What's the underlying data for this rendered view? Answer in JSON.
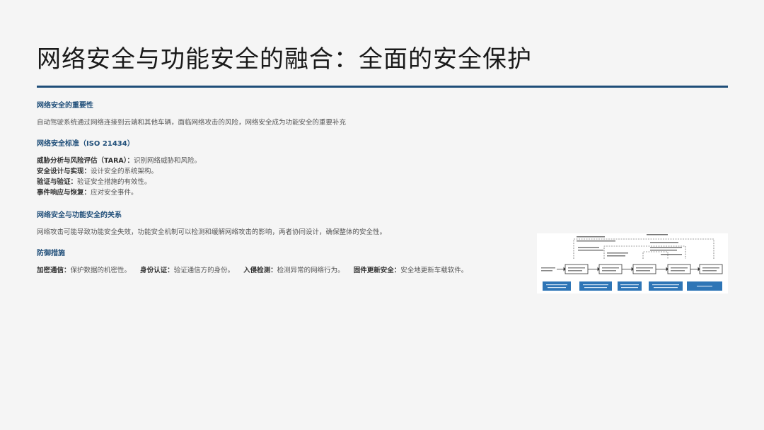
{
  "title": "网络安全与功能安全的融合：全面的安全保护",
  "sections": {
    "importance": {
      "heading": "网络安全的重要性",
      "text": "自动驾驶系统通过网络连接到云端和其他车辆，面临网络攻击的风险，网络安全成为功能安全的重要补充"
    },
    "standard": {
      "heading": "网络安全标准（ISO 21434）",
      "items": [
        {
          "label": "威胁分析与风险评估（TARA）：",
          "text": "识别网络威胁和风险。"
        },
        {
          "label": "安全设计与实现：",
          "text": "设计安全的系统架构。"
        },
        {
          "label": "验证与验证：",
          "text": "验证安全措施的有效性。"
        },
        {
          "label": "事件响应与恢复：",
          "text": "应对安全事件。"
        }
      ]
    },
    "relation": {
      "heading": "网络安全与功能安全的关系",
      "text": "网络攻击可能导致功能安全失效，功能安全机制可以检测和缓解网络攻击的影响，两者协同设计，确保整体的安全性。"
    },
    "defense": {
      "heading": "防御措施",
      "items": [
        {
          "label": "加密通信：",
          "text": "保护数据的机密性。"
        },
        {
          "label": "身份认证：",
          "text": "验证通信方的身份。"
        },
        {
          "label": "入侵检测：",
          "text": "检测异常的网络行为。"
        },
        {
          "label": "固件更新安全：",
          "text": "安全地更新车载软件。"
        }
      ]
    }
  },
  "colors": {
    "accent": "#1f4e79",
    "diagram_box": "#2e75b6"
  }
}
